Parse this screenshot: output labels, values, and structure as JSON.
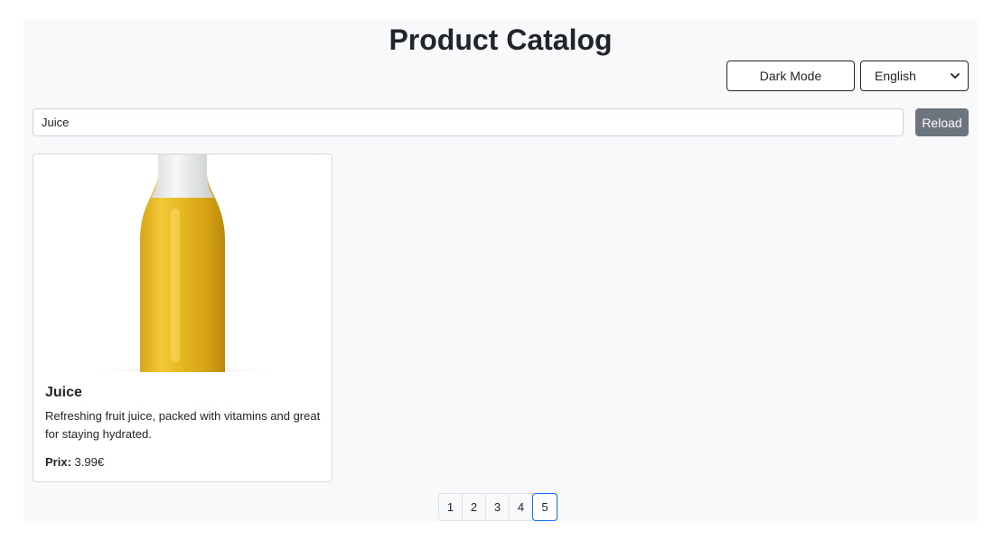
{
  "header": {
    "title": "Product Catalog",
    "dark_mode_label": "Dark Mode",
    "language": {
      "selected": "English"
    }
  },
  "search": {
    "value": "Juice",
    "reload_label": "Reload"
  },
  "products": [
    {
      "name": "Juice",
      "description": "Refreshing fruit juice, packed with vitamins and great for staying hydrated.",
      "price_label": "Prix:",
      "price": "3.99€",
      "image": "juice-bottle-image"
    }
  ],
  "pagination": {
    "pages": [
      "1",
      "2",
      "3",
      "4",
      "5"
    ],
    "current": "5"
  },
  "colors": {
    "page_background": "#f8f9fa",
    "reload_button": "#6c757d",
    "active_page_border": "#0d6efd",
    "juice": "#e6b41e"
  }
}
